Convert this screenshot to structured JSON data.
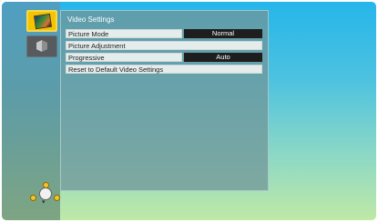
{
  "sidebar": {
    "items": [
      {
        "icon": "video-settings-icon",
        "selected": true
      },
      {
        "icon": "cube-icon",
        "selected": false
      }
    ],
    "nav_icon": "dpad-navigation-icon"
  },
  "panel": {
    "title": "Video Settings",
    "rows": [
      {
        "label": "Picture Mode",
        "value": "Normal"
      },
      {
        "label": "Picture Adjustment",
        "value": ""
      },
      {
        "label": "Progressive",
        "value": "Auto"
      },
      {
        "label": "Reset to Default Video Settings",
        "value": ""
      }
    ]
  },
  "colors": {
    "accent_selected": "#f5c400",
    "value_background": "#1e1e1e",
    "panel_background": "#70989a"
  }
}
